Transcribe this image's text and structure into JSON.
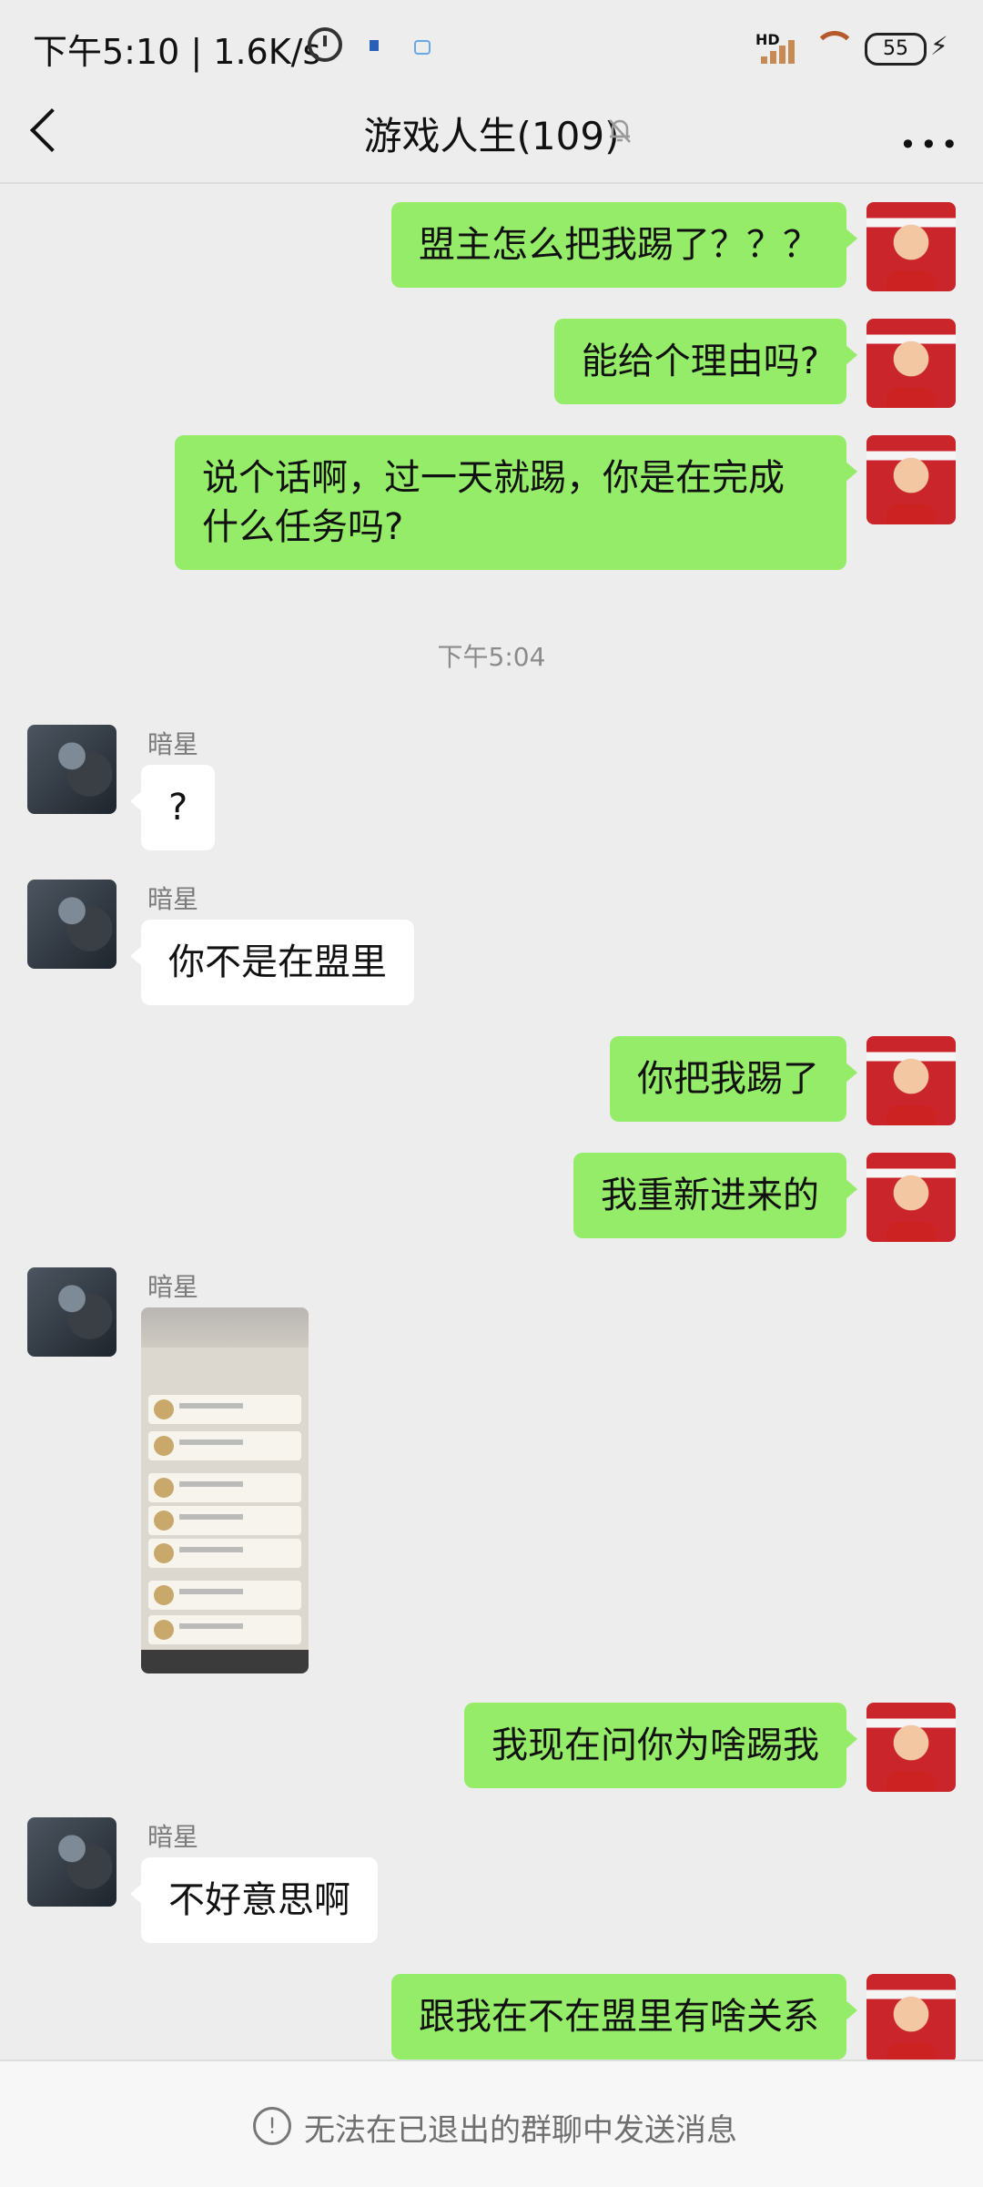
{
  "status_bar": {
    "time": "下午5:10 | 1.6K/s",
    "network_type": "HD",
    "battery": "55"
  },
  "header": {
    "title": "游戏人生(109)"
  },
  "messages": [
    {
      "side": "me",
      "text": "盟主怎么把我踢了？？？"
    },
    {
      "side": "me",
      "text": "能给个理由吗?"
    },
    {
      "side": "me",
      "text": "说个话啊，过一天就踢，你是在完成什么任务吗?"
    },
    {
      "timestamp": "下午5:04"
    },
    {
      "side": "other",
      "sender": "暗星",
      "text": "?"
    },
    {
      "side": "other",
      "sender": "暗星",
      "text": "你不是在盟里"
    },
    {
      "side": "me",
      "text": "你把我踢了"
    },
    {
      "side": "me",
      "text": "我重新进来的"
    },
    {
      "side": "other",
      "sender": "暗星",
      "type": "image"
    },
    {
      "side": "me",
      "text": "我现在问你为啥踢我"
    },
    {
      "side": "other",
      "sender": "暗星",
      "text": "不好意思啊"
    },
    {
      "side": "me",
      "text": "跟我在不在盟里有啥关系"
    }
  ],
  "footer": {
    "notice": "无法在已退出的群聊中发送消息"
  },
  "colors": {
    "bubble_me": "#95ec69",
    "bubble_other": "#ffffff",
    "background": "#ededed"
  }
}
